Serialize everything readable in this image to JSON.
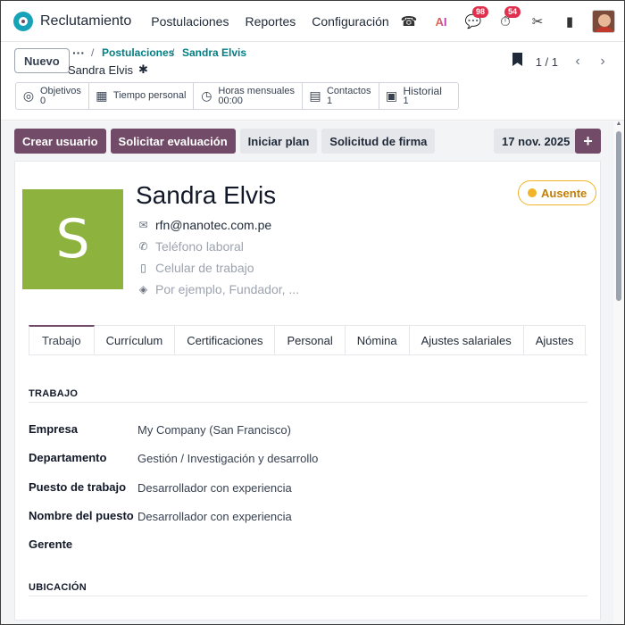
{
  "navbar": {
    "app_name": "Reclutamiento",
    "menu": [
      "Postulaciones",
      "Reportes",
      "Configuración"
    ],
    "ai_label": "AI",
    "messages_badge": "98",
    "activities_badge": "54"
  },
  "control_panel": {
    "new_button": "Nuevo",
    "breadcrumb_dots": "···",
    "breadcrumb_sep": "/",
    "breadcrumb_parent": "Postulaciones",
    "breadcrumb_current": "Sandra Elvis",
    "record_name": "Sandra Elvis",
    "pager": "1 / 1"
  },
  "stats": [
    {
      "label": "Objetivos",
      "value": "0",
      "icon": "target-icon"
    },
    {
      "label": "Tiempo personal",
      "value": "",
      "icon": "calendar-icon"
    },
    {
      "label": "Horas mensuales",
      "value": "00:00",
      "icon": "clock-icon"
    },
    {
      "label": "Contactos",
      "value": "1",
      "icon": "contact-card-icon"
    },
    {
      "label": "Historial",
      "value": "1",
      "icon": "history-icon"
    }
  ],
  "actions": {
    "create_user": "Crear usuario",
    "request_evaluation": "Solicitar evaluación",
    "start_plan": "Iniciar plan",
    "signature_request": "Solicitud de firma",
    "date": "17 nov. 2025",
    "plus": "+"
  },
  "employee": {
    "initial": "S",
    "avatar_color": "#8db33e",
    "name": "Sandra Elvis",
    "status": "Ausente",
    "status_color": "#f0b429",
    "email": "rfn@nanotec.com.pe",
    "work_phone_placeholder": "Teléfono laboral",
    "mobile_placeholder": "Celular de trabajo",
    "tags_placeholder": "Por ejemplo, Fundador, ..."
  },
  "tabs": [
    "Trabajo",
    "Currículum",
    "Certificaciones",
    "Personal",
    "Nómina",
    "Ajustes salariales",
    "Ajustes"
  ],
  "work_section": {
    "title": "TRABAJO",
    "fields": [
      {
        "label": "Empresa",
        "value": "My Company (San Francisco)"
      },
      {
        "label": "Departamento",
        "value": "Gestión / Investigación y desarrollo"
      },
      {
        "label": "Puesto de trabajo",
        "value": "Desarrollador con experiencia"
      },
      {
        "label": "Nombre del puesto",
        "value": "Desarrollador con experiencia"
      },
      {
        "label": "Gerente",
        "value": ""
      }
    ]
  },
  "location_section": {
    "title": "UBICACIÓN"
  },
  "colors": {
    "primary": "#714b67",
    "link": "#017e84"
  }
}
